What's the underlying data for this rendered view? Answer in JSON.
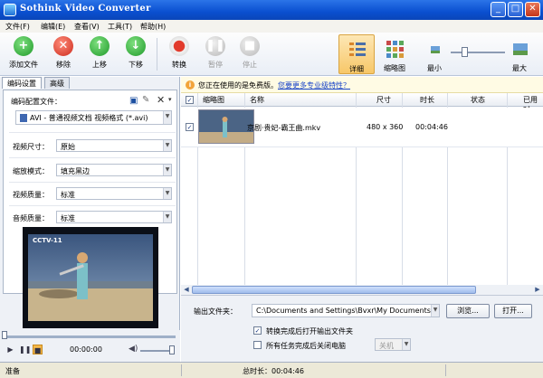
{
  "window": {
    "title": "Sothink Video Converter"
  },
  "menu": [
    "文件(F)",
    "编辑(E)",
    "查看(V)",
    "工具(T)",
    "帮助(H)"
  ],
  "toolbar": {
    "add": "添加文件",
    "remove": "移除",
    "up": "上移",
    "down": "下移",
    "convert": "转换",
    "pause": "暂停",
    "stop": "停止",
    "view_detail": "详细",
    "view_thumb": "缩略图",
    "zoom_min": "最小",
    "zoom_max": "最大",
    "zoom_level": 0.25
  },
  "left_panel": {
    "tabs": [
      "编码设置",
      "高级"
    ],
    "profile_label": "编码配置文件：",
    "profile_value": "AVI - 普通视频文档 视频格式 (*.avi)",
    "fields": [
      {
        "label": "视频尺寸：",
        "value": "原始"
      },
      {
        "label": "缩放模式：",
        "value": "填充黑边"
      },
      {
        "label": "视频质量：",
        "value": "标准"
      },
      {
        "label": "音频质量：",
        "value": "标准"
      }
    ],
    "preview_overlay": "CCTV-11",
    "player_time": "00:00:00",
    "seek_position": 0.0
  },
  "info_bar": {
    "text": "您正在使用的是免费版。",
    "link": "您要更多专业级特性？"
  },
  "grid": {
    "columns": [
      "缩略图",
      "名称",
      "尺寸",
      "时长",
      "状态",
      "已用时"
    ],
    "rows": [
      {
        "checked": true,
        "name": "京剧·贵妃-霸王曲.mkv",
        "size": "480 x 360",
        "duration": "00:04:46",
        "status": "",
        "elapsed": ""
      }
    ]
  },
  "output": {
    "folder_label": "输出文件夹：",
    "folder_value": "C:\\Documents and Settings\\Bvxr\\My Documents\\My Video",
    "browse": "浏览...",
    "open": "打开...",
    "opt1": "转换完成后打开输出文件夹",
    "opt1_checked": true,
    "opt2": "所有任务完成后关闭电脑",
    "opt2_checked": false,
    "opt2_select": "关机"
  },
  "status": {
    "ready": "准备",
    "total": "总时长：00:04:46"
  }
}
